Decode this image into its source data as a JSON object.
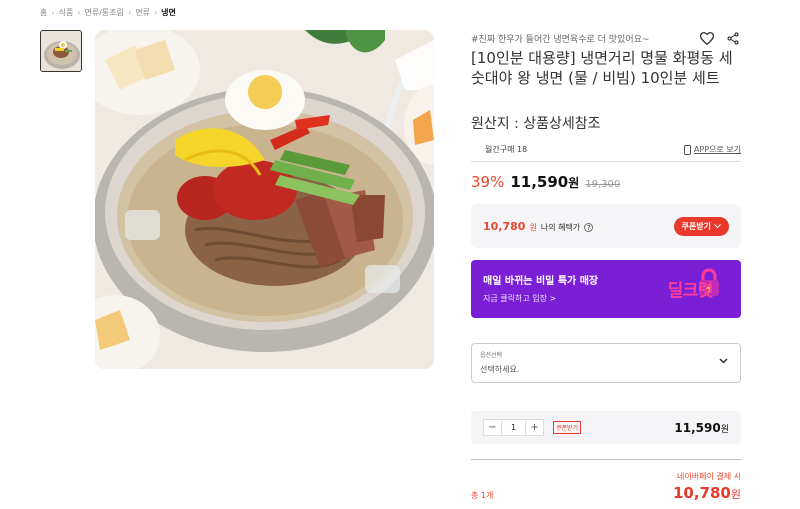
{
  "breadcrumb": [
    "홈",
    "식품",
    "면류/통조림",
    "면류",
    "냉면"
  ],
  "product": {
    "tagline": "#진짜 한우가 들어간 냉면육수로 더 맛있어요~",
    "title": "[10인분 대용량] 냉면거리 명물 화평동 세숫대야 왕 냉면 (물 / 비빔) 10인분 세트",
    "origin": "원산지 : 상품상세참조",
    "monthly_purchases": "월간구매 18",
    "app_link": "APP으로 보기",
    "image_alt": "냉면"
  },
  "price": {
    "discount": "39%",
    "sale_price": "11,590",
    "unit": "원",
    "original_price": "19,300"
  },
  "benefit": {
    "price": "10,780",
    "unit": "원",
    "label": "나의 혜택가",
    "help": "?",
    "coupon_button": "쿠폰받기"
  },
  "promo": {
    "title": "매일 바뀌는 비밀 특가 매장",
    "subtitle": "지금 클릭하고 입장 >",
    "brand": "딜크럿"
  },
  "option": {
    "label": "옵션선택",
    "placeholder": "선택하세요."
  },
  "quantity": {
    "minus": "−",
    "value": "1",
    "plus": "+",
    "coupon": "쿠폰받기",
    "price": "11,590",
    "unit": "원"
  },
  "total": {
    "label": "총 1개",
    "naverpay_label": "네이버페이 결제 시",
    "price": "10,780",
    "unit": "원"
  },
  "colors": {
    "accent_red": "#e8392c",
    "promo_purple": "#7b1fd6"
  }
}
